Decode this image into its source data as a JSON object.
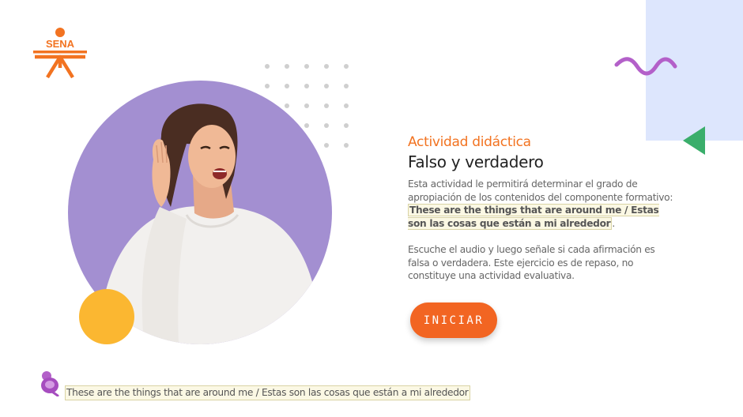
{
  "brand": {
    "logo_text": "SENA",
    "colors": {
      "orange": "#f27321",
      "purple": "#a38fd1",
      "green": "#3aae6b",
      "yellow": "#fbb731",
      "lavender": "#dde6fd"
    }
  },
  "activity": {
    "kicker": "Actividad didáctica",
    "title": "Falso y verdadero",
    "intro": "Esta actividad le permitirá determinar el grado de apropiación de los contenidos del componente formativo:",
    "component_title": "These are the things that are around me / Estas son las cosas que están a mi alrededor",
    "intro_end": ".",
    "instructions": "Escuche el audio y luego señale si cada afirmación es falsa o verdadera.  Este ejercicio es de repaso, no constituye una actividad evaluativa."
  },
  "buttons": {
    "start": "INICIAR"
  },
  "footer": {
    "audio_icon": "microphone-icon",
    "caption": "These are the things that are around me / Estas son las cosas que están a mi alrededor"
  },
  "decorations": {
    "image": "woman-listening-photo",
    "icons": [
      "dot-grid",
      "wave-icon",
      "triangle-icon"
    ]
  }
}
